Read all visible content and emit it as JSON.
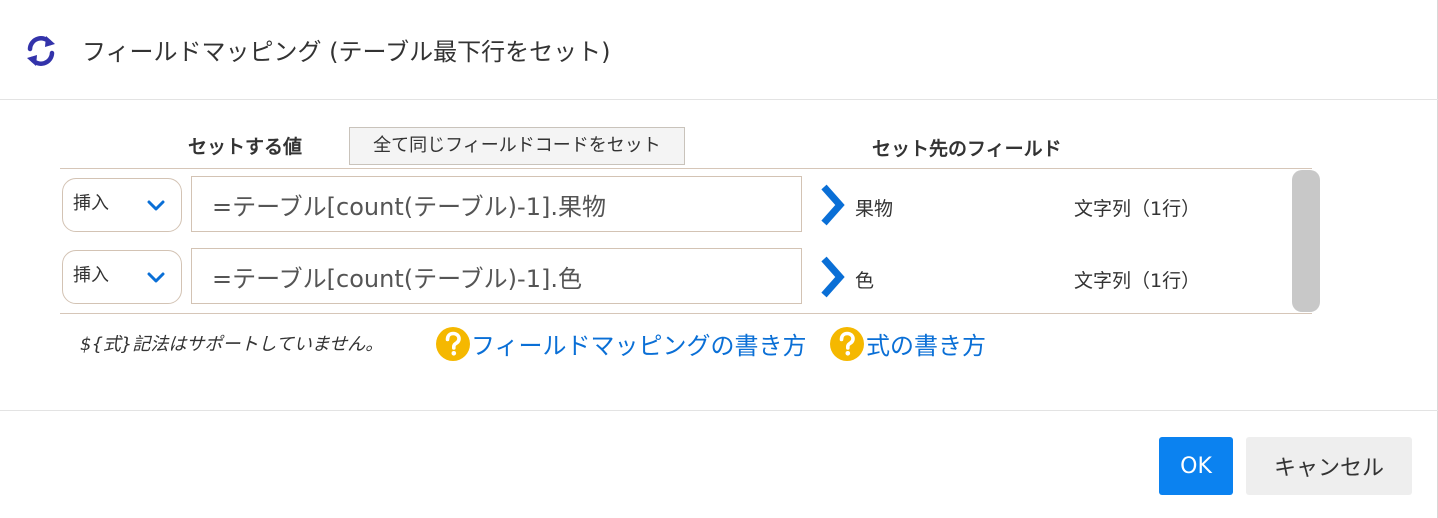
{
  "header": {
    "title": "フィールドマッピング (テーブル最下行をセット)",
    "icon": "refresh-icon",
    "icon_color": "#3333aa"
  },
  "columns": {
    "value_label": "セットする値",
    "same_code_button_label": "全て同じフィールドコードをセット",
    "target_label": "セット先のフィールド"
  },
  "rows": [
    {
      "mode": "挿入",
      "formula": "=テーブル[count(テーブル)-1].果物",
      "field_name": "果物",
      "field_type": "文字列（1行）"
    },
    {
      "mode": "挿入",
      "formula": "=テーブル[count(テーブル)-1].色",
      "field_name": "色",
      "field_type": "文字列（1行）"
    }
  ],
  "help": {
    "note": "${式}記法はサポートしていません。",
    "link_mapping": "フィールドマッピングの書き方",
    "link_formula": "式の書き方",
    "icon": "question-circle-icon",
    "icon_color": "#f5b800",
    "link_color": "#0a6fd6"
  },
  "footer": {
    "ok_label": "OK",
    "cancel_label": "キャンセル",
    "ok_color": "#0b82f0"
  },
  "colors": {
    "chevron": "#0a6fd6",
    "arrow": "#0a6fd6"
  }
}
